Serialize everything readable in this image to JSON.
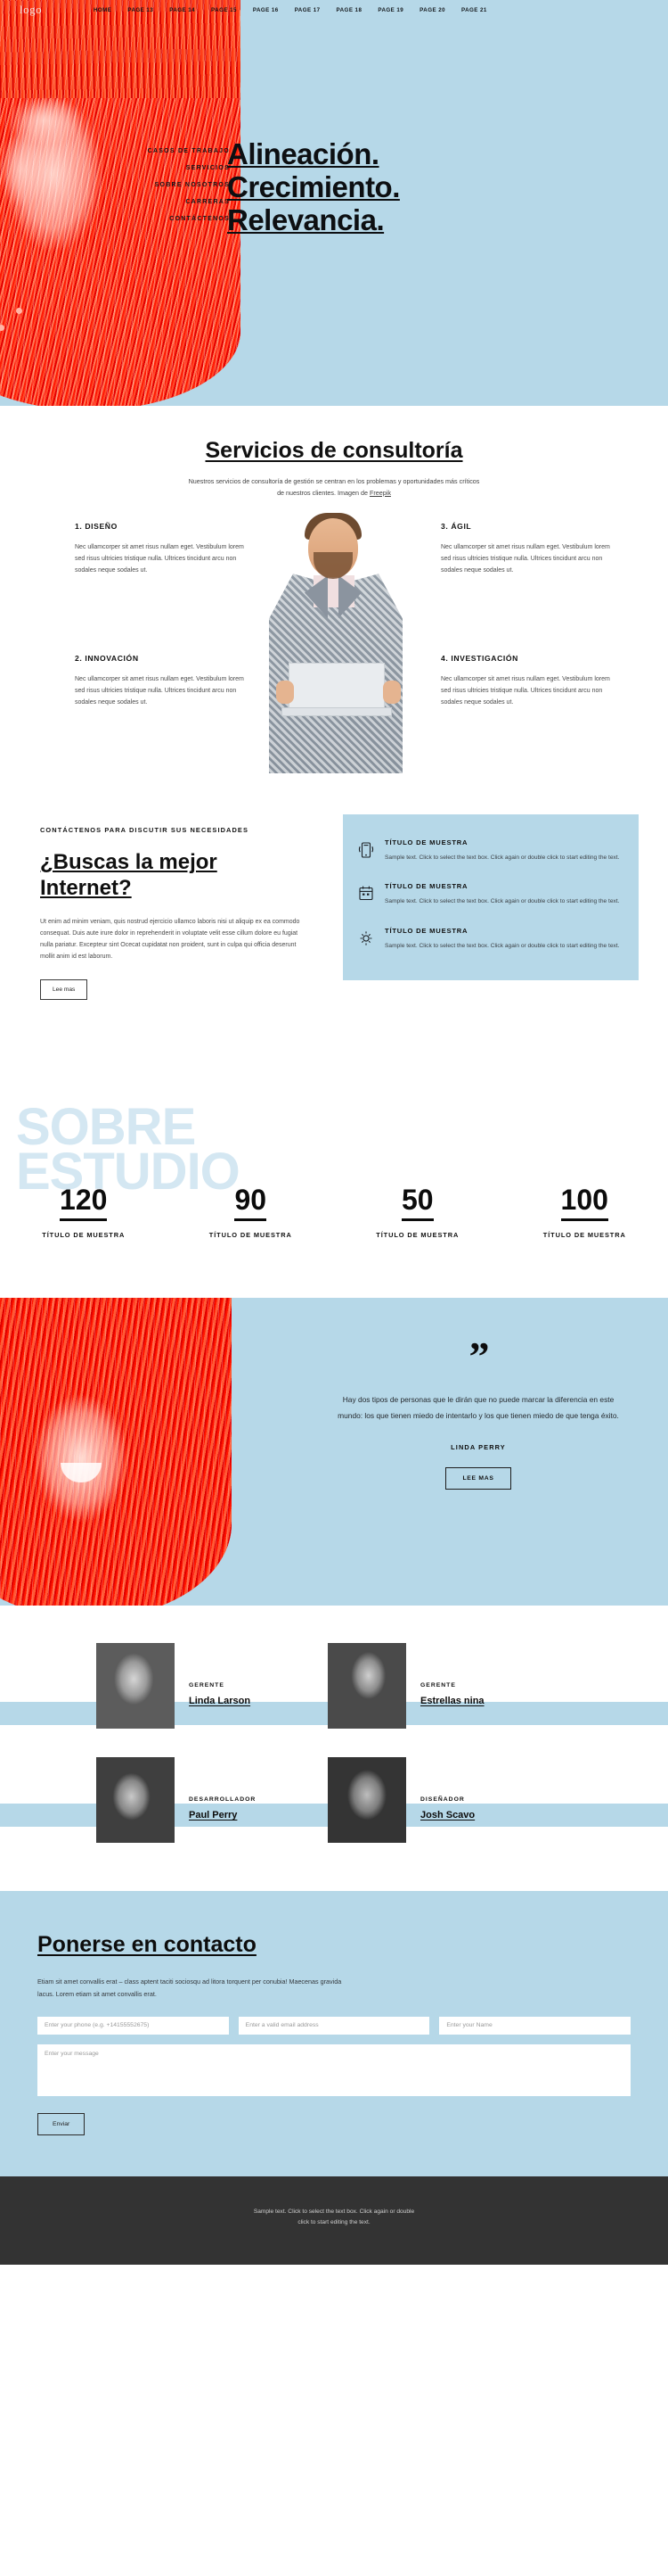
{
  "nav": {
    "logo": "logo",
    "links": [
      {
        "label": "HOME",
        "active": true
      },
      {
        "label": "PAGE 13",
        "active": false
      },
      {
        "label": "PAGE 14",
        "active": false
      },
      {
        "label": "PAGE 15",
        "active": false
      },
      {
        "label": "PAGE 16",
        "active": false
      },
      {
        "label": "PAGE 17",
        "active": false
      },
      {
        "label": "PAGE 18",
        "active": false
      },
      {
        "label": "PAGE 19",
        "active": false
      },
      {
        "label": "PAGE 20",
        "active": false
      },
      {
        "label": "PAGE 21",
        "active": false
      }
    ]
  },
  "hero": {
    "menu": [
      "CASOS DE TRABAJO",
      "SERVICIOS",
      "SOBRE NOSOTROS",
      "CARRERAS",
      "CONTÁCTENOS"
    ],
    "title_lines": [
      "Alineación.",
      "Crecimiento.",
      "Relevancia."
    ],
    "bg_color": "#b6d8e8"
  },
  "services": {
    "title": "Servicios de consultoría",
    "subtitle_line1": "Nuestros servicios de consultoría de gestión se centran en los problemas y",
    "subtitle_line2": "oportunidades más críticos de nuestros clientes. Imagen de",
    "subtitle_link": "Freepik",
    "items": [
      {
        "heading": "1. DISEÑO",
        "body": "Nec ullamcorper sit amet risus nullam eget. Vestibulum lorem sed risus ultricies tristique nulla. Ultrices tincidunt arcu non sodales neque sodales ut."
      },
      {
        "heading": "2. INNOVACIÓN",
        "body": "Nec ullamcorper sit amet risus nullam eget. Vestibulum lorem sed risus ultricies tristique nulla. Ultrices tincidunt arcu non sodales neque sodales ut."
      },
      {
        "heading": "3. ÁGIL",
        "body": "Nec ullamcorper sit amet risus nullam eget. Vestibulum lorem sed risus ultricies tristique nulla. Ultrices tincidunt arcu non sodales neque sodales ut."
      },
      {
        "heading": "4. INVESTIGACIÓN",
        "body": "Nec ullamcorper sit amet risus nullam eget. Vestibulum lorem sed risus ultricies tristique nulla. Ultrices tincidunt arcu non sodales neque sodales ut."
      }
    ]
  },
  "needs": {
    "kicker": "CONTÁCTENOS PARA DISCUTIR SUS NECESIDADES",
    "heading": "¿Buscas la mejor Internet?",
    "paragraph": "Ut enim ad minim veniam, quis nostrud ejercicio ullamco laboris nisi ut aliquip ex ea commodo consequat. Duis aute irure dolor in reprehenderit in voluptate velit esse cillum dolore eu fugiat nulla pariatur. Excepteur sint Ocecat cupidatat non proident, sunt in culpa qui officia deserunt mollit anim id est laborum.",
    "button": "Lee mas",
    "cards": [
      {
        "icon": "mobile-phone-icon",
        "title": "TÍTULO DE MUESTRA",
        "body": "Sample text. Click to select the text box. Click again or double click to start editing the text."
      },
      {
        "icon": "calendar-icon",
        "title": "TÍTULO DE MUESTRA",
        "body": "Sample text. Click to select the text box. Click again or double click to start editing the text."
      },
      {
        "icon": "gear-icon",
        "title": "TÍTULO DE MUESTRA",
        "body": "Sample text. Click to select the text box. Click again or double click to start editing the text."
      }
    ],
    "panel_color": "#b6d8e8"
  },
  "stats": {
    "ghost_line1": "SOBRE",
    "ghost_line2": "ESTUDIO",
    "ghost_color": "#d4e7f2",
    "items": [
      {
        "number": "120",
        "label": "TÍTULO DE MUESTRA"
      },
      {
        "number": "90",
        "label": "TÍTULO DE MUESTRA"
      },
      {
        "number": "50",
        "label": "TÍTULO DE MUESTRA"
      },
      {
        "number": "100",
        "label": "TÍTULO DE MUESTRA"
      }
    ]
  },
  "quote": {
    "mark": "”",
    "text": "Hay dos tipos de personas que le dirán que no puede marcar la diferencia en este mundo: los que tienen miedo de intentarlo y los que tienen miedo de que tenga éxito.",
    "author": "LINDA PERRY",
    "button": "LEE MAS",
    "bg_color": "#b6d8e8"
  },
  "team": {
    "members": [
      {
        "role": "GERENTE",
        "name": "Linda Larson"
      },
      {
        "role": "GERENTE",
        "name": "Estrellas nina"
      },
      {
        "role": "DESARROLLADOR",
        "name": "Paul Perry"
      },
      {
        "role": "DISEÑADOR",
        "name": "Josh Scavo"
      }
    ],
    "band_color": "#b6d8e8"
  },
  "contact": {
    "heading": "Ponerse en contacto",
    "paragraph": "Etiam sit amet convallis erat – class aptent taciti sociosqu ad litora torquent per conubia! Maecenas gravida lacus. Lorem etiam sit amet convallis erat.",
    "phone_placeholder": "Enter your phone (e.g. +14155552675)",
    "email_placeholder": "Enter a valid email address",
    "name_placeholder": "Enter your Name",
    "message_placeholder": "Enter your message",
    "submit": "Enviar",
    "bg_color": "#b6d8e8"
  },
  "footer": {
    "line1": "Sample text. Click to select the text box. Click again or double",
    "line2": "click to start editing the text.",
    "bg_color": "#333333"
  }
}
